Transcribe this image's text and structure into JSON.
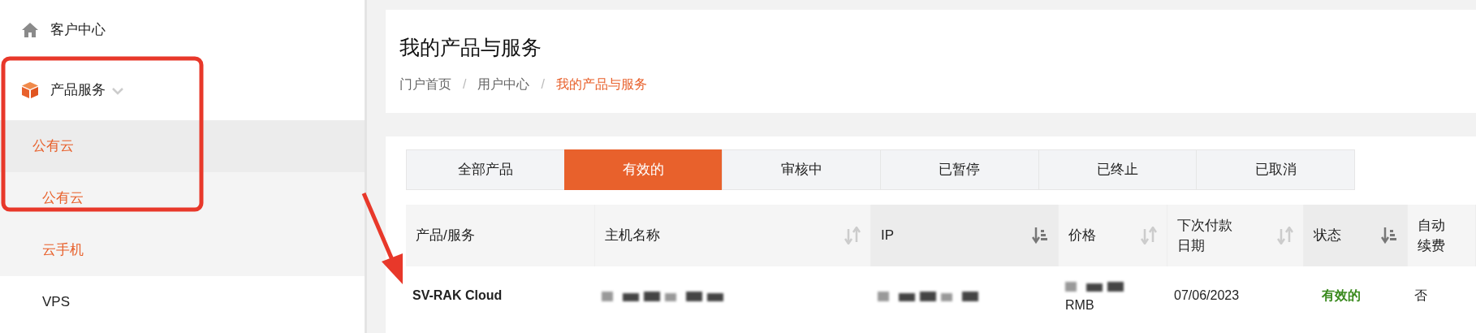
{
  "sidebar": {
    "items": [
      {
        "label": "客户中心"
      },
      {
        "label": "产品服务",
        "expanded": true,
        "children": [
          {
            "label": "公有云",
            "selected": true,
            "highlighted": true,
            "children": [
              {
                "label": "公有云",
                "highlighted": true
              },
              {
                "label": "云手机",
                "highlighted": true
              }
            ]
          },
          {
            "label": "VPS",
            "selected": false,
            "highlighted": false
          }
        ]
      }
    ]
  },
  "page": {
    "title": "我的产品与服务",
    "breadcrumb": [
      {
        "label": "门户首页",
        "current": false
      },
      {
        "label": "用户中心",
        "separator": "/",
        "current": false
      },
      {
        "label": "我的产品与服务",
        "separator": "/",
        "current": true
      }
    ]
  },
  "tabs": [
    {
      "label": "全部产品",
      "selected": false
    },
    {
      "label": "有效的",
      "selected": true
    },
    {
      "label": "审核中",
      "selected": false
    },
    {
      "label": "已暂停",
      "selected": false
    },
    {
      "label": "已终止",
      "selected": false
    },
    {
      "label": "已取消",
      "selected": false
    }
  ],
  "table": {
    "columns": [
      {
        "label": "产品/服务",
        "kind": "plain"
      },
      {
        "label": "主机名称",
        "kind": "sortable"
      },
      {
        "label": "IP",
        "kind": "sorted"
      },
      {
        "label": "价格",
        "kind": "sortable"
      },
      {
        "label": "下次付款日期",
        "kind": "sortable"
      },
      {
        "label": "状态",
        "kind": "sorted"
      },
      {
        "label": "自动续费",
        "kind": "plain"
      }
    ],
    "rows": [
      {
        "product": "SV-RAK Cloud",
        "price": "RMB",
        "next_due": "07/06/2023",
        "status": "有效的",
        "auto_renew": "否"
      }
    ]
  }
}
